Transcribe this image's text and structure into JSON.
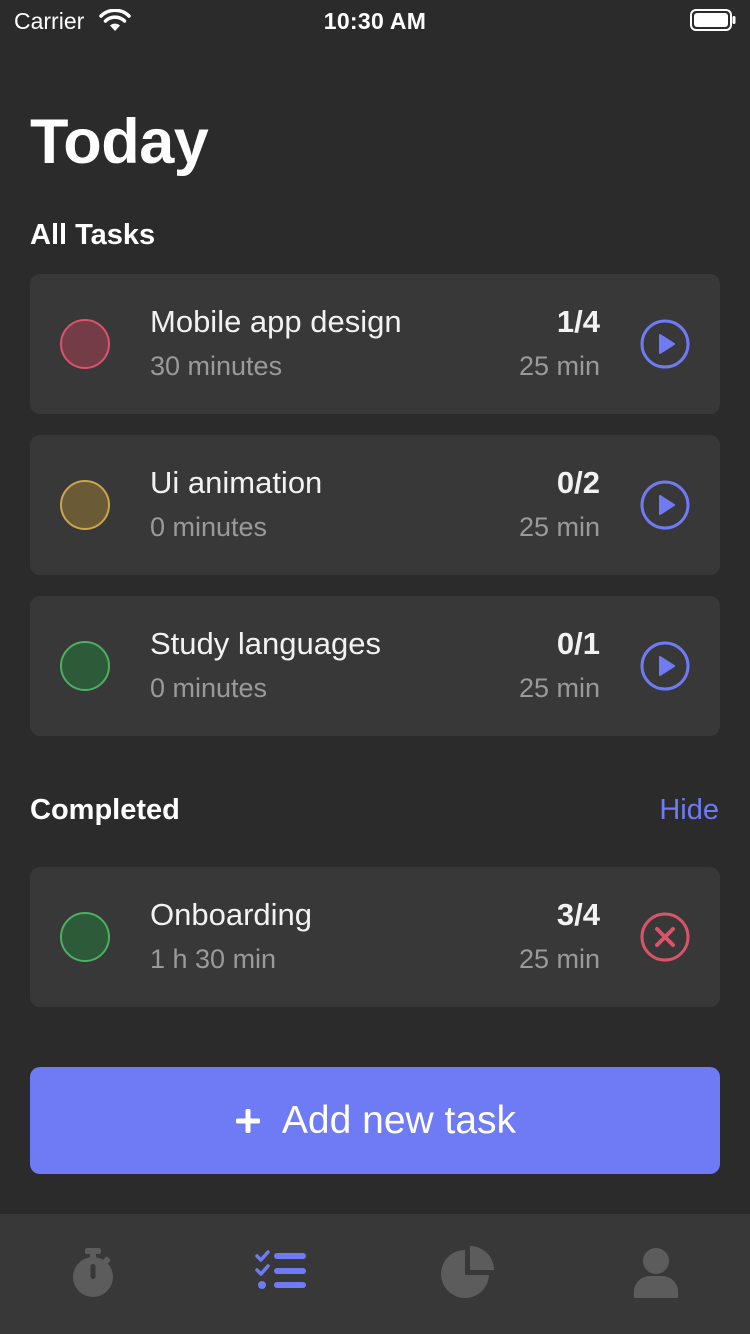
{
  "status_bar": {
    "carrier": "Carrier",
    "time": "10:30 AM"
  },
  "title": "Today",
  "sections": {
    "all_tasks": "All Tasks",
    "completed": "Completed",
    "hide": "Hide"
  },
  "tasks": [
    {
      "name": "Mobile app design",
      "duration": "30 minutes",
      "count": "1/4",
      "pomodoro": "25 min",
      "color": "#d9546a",
      "fill": "#743c47",
      "action": "play-icon"
    },
    {
      "name": "Ui animation",
      "duration": "0 minutes",
      "count": "0/2",
      "pomodoro": "25 min",
      "color": "#c9a64e",
      "fill": "#6b5a36",
      "action": "play-icon"
    },
    {
      "name": "Study languages",
      "duration": "0 minutes",
      "count": "0/1",
      "pomodoro": "25 min",
      "color": "#4caf63",
      "fill": "#2d5a39",
      "action": "play-icon"
    }
  ],
  "completed_tasks": [
    {
      "name": "Onboarding",
      "duration": "1 h 30 min",
      "count": "3/4",
      "pomodoro": "25 min",
      "color": "#4caf63",
      "fill": "#2d5a39",
      "action": "close-circle-icon"
    }
  ],
  "add_button": {
    "label": "Add new task",
    "icon": "plus-icon"
  },
  "tab_bar": [
    {
      "name": "timer-icon",
      "active": false
    },
    {
      "name": "task-list-icon",
      "active": true
    },
    {
      "name": "stats-pie-icon",
      "active": false
    },
    {
      "name": "profile-icon",
      "active": false
    }
  ],
  "colors": {
    "accent": "#6e7bf4",
    "danger": "#d9546a",
    "background": "#2b2b2b",
    "card": "#383838"
  }
}
